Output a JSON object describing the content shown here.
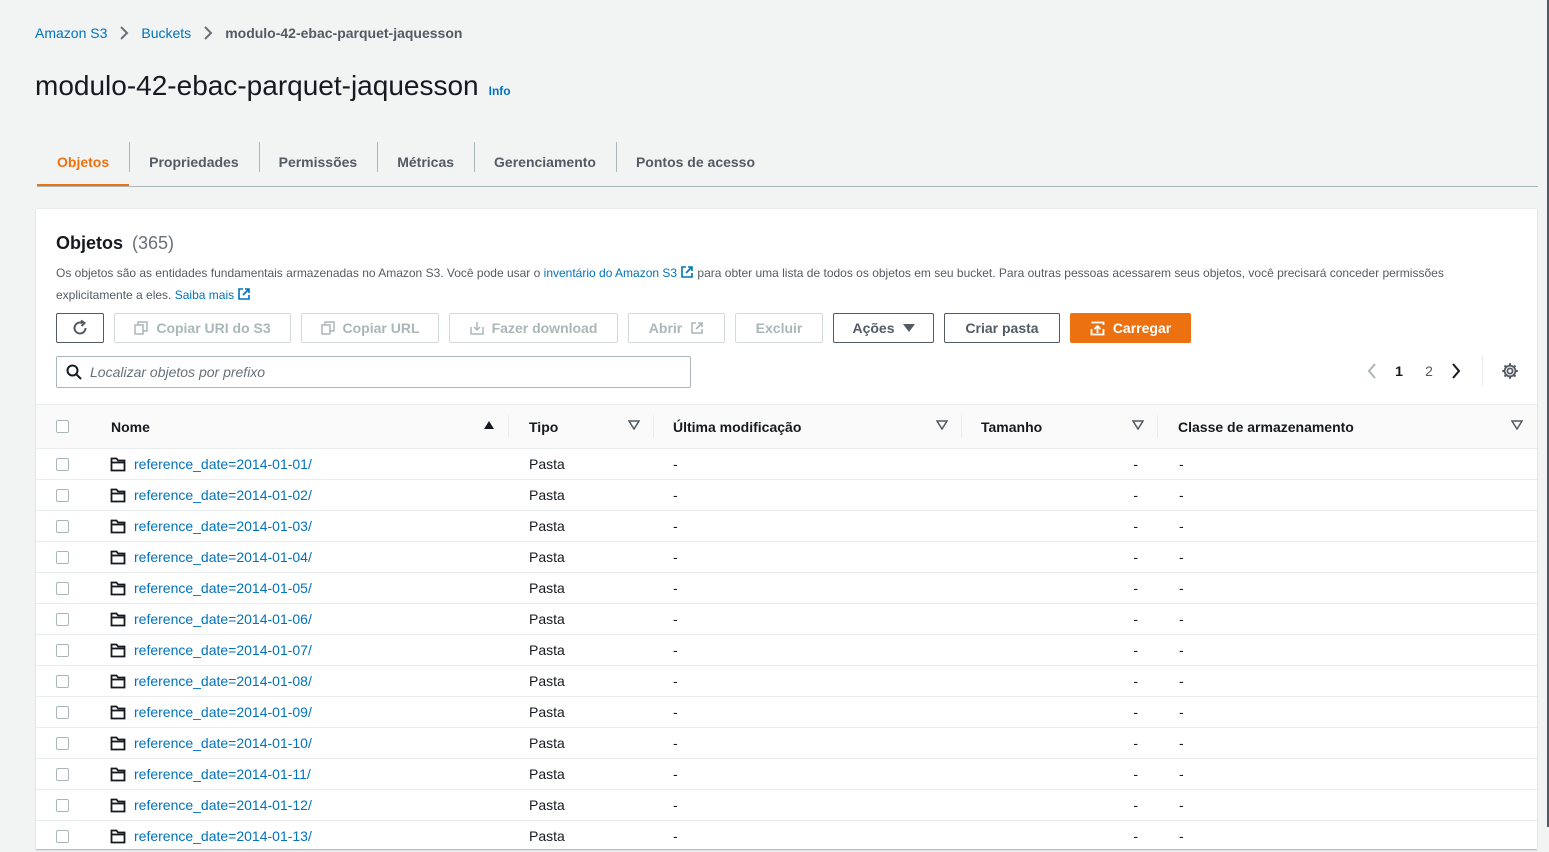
{
  "breadcrumb": {
    "root": "Amazon S3",
    "buckets": "Buckets",
    "current": "modulo-42-ebac-parquet-jaquesson"
  },
  "page": {
    "title": "modulo-42-ebac-parquet-jaquesson",
    "info": "Info"
  },
  "tabs": [
    {
      "label": "Objetos",
      "active": true
    },
    {
      "label": "Propriedades"
    },
    {
      "label": "Permissões"
    },
    {
      "label": "Métricas"
    },
    {
      "label": "Gerenciamento"
    },
    {
      "label": "Pontos de acesso"
    }
  ],
  "objects": {
    "heading": "Objetos",
    "count": "(365)",
    "desc_1": "Os objetos são as entidades fundamentais armazenadas no Amazon S3. Você pode usar o",
    "desc_link": "inventário do Amazon S3",
    "desc_2": "para obter uma lista de todos os objetos em seu bucket. Para outras pessoas acessarem seus objetos, você precisará conceder permissões explicitamente a eles.",
    "learn_more": "Saiba mais"
  },
  "toolbar": {
    "copy_uri": "Copiar URI do S3",
    "copy_url": "Copiar URL",
    "download": "Fazer download",
    "open": "Abrir",
    "delete": "Excluir",
    "actions": "Ações",
    "create_folder": "Criar pasta",
    "upload": "Carregar"
  },
  "search": {
    "placeholder": "Localizar objetos por prefixo",
    "value": ""
  },
  "pagination": {
    "pages": [
      "1",
      "2"
    ],
    "current": "1"
  },
  "table": {
    "columns": {
      "name": "Nome",
      "type": "Tipo",
      "modified": "Última modificação",
      "size": "Tamanho",
      "storage": "Classe de armazenamento"
    },
    "rows": [
      {
        "name": "reference_date=2014-01-01/",
        "type": "Pasta",
        "modified": "-",
        "size": "-",
        "storage": "-"
      },
      {
        "name": "reference_date=2014-01-02/",
        "type": "Pasta",
        "modified": "-",
        "size": "-",
        "storage": "-"
      },
      {
        "name": "reference_date=2014-01-03/",
        "type": "Pasta",
        "modified": "-",
        "size": "-",
        "storage": "-"
      },
      {
        "name": "reference_date=2014-01-04/",
        "type": "Pasta",
        "modified": "-",
        "size": "-",
        "storage": "-"
      },
      {
        "name": "reference_date=2014-01-05/",
        "type": "Pasta",
        "modified": "-",
        "size": "-",
        "storage": "-"
      },
      {
        "name": "reference_date=2014-01-06/",
        "type": "Pasta",
        "modified": "-",
        "size": "-",
        "storage": "-"
      },
      {
        "name": "reference_date=2014-01-07/",
        "type": "Pasta",
        "modified": "-",
        "size": "-",
        "storage": "-"
      },
      {
        "name": "reference_date=2014-01-08/",
        "type": "Pasta",
        "modified": "-",
        "size": "-",
        "storage": "-"
      },
      {
        "name": "reference_date=2014-01-09/",
        "type": "Pasta",
        "modified": "-",
        "size": "-",
        "storage": "-"
      },
      {
        "name": "reference_date=2014-01-10/",
        "type": "Pasta",
        "modified": "-",
        "size": "-",
        "storage": "-"
      },
      {
        "name": "reference_date=2014-01-11/",
        "type": "Pasta",
        "modified": "-",
        "size": "-",
        "storage": "-"
      },
      {
        "name": "reference_date=2014-01-12/",
        "type": "Pasta",
        "modified": "-",
        "size": "-",
        "storage": "-"
      },
      {
        "name": "reference_date=2014-01-13/",
        "type": "Pasta",
        "modified": "-",
        "size": "-",
        "storage": "-"
      }
    ]
  },
  "colors": {
    "accent": "#ec7211",
    "link": "#0073bb",
    "text": "#16191f",
    "muted": "#545b64",
    "background": "#f2f3f3"
  },
  "icons": [
    "chevron-right-icon",
    "refresh-icon",
    "copy-icon",
    "download-icon",
    "external-link-icon",
    "caret-down-icon",
    "upload-icon",
    "search-icon",
    "chevron-left-icon",
    "gear-icon",
    "sort-ascending-icon",
    "sort-caret-icon",
    "folder-icon"
  ]
}
